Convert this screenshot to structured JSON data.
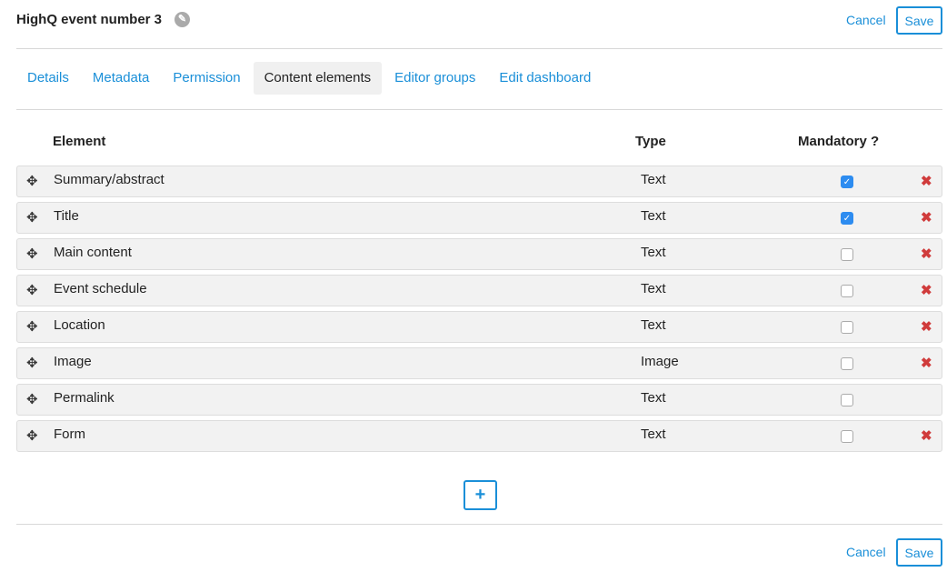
{
  "header": {
    "title": "HighQ event number 3",
    "cancel": "Cancel",
    "save": "Save"
  },
  "tabs": [
    {
      "label": "Details"
    },
    {
      "label": "Metadata"
    },
    {
      "label": "Permission"
    },
    {
      "label": "Content elements",
      "active": true
    },
    {
      "label": "Editor groups"
    },
    {
      "label": "Edit dashboard"
    }
  ],
  "table": {
    "headers": {
      "element": "Element",
      "type": "Type",
      "mandatory": "Mandatory ?"
    },
    "rows": [
      {
        "name": "Summary/abstract",
        "type": "Text",
        "mandatory": true,
        "deletable": true
      },
      {
        "name": "Title",
        "type": "Text",
        "mandatory": true,
        "deletable": true
      },
      {
        "name": "Main content",
        "type": "Text",
        "mandatory": false,
        "deletable": true
      },
      {
        "name": "Event schedule",
        "type": "Text",
        "mandatory": false,
        "deletable": true
      },
      {
        "name": "Location",
        "type": "Text",
        "mandatory": false,
        "deletable": true
      },
      {
        "name": "Image",
        "type": "Image",
        "mandatory": false,
        "deletable": true
      },
      {
        "name": "Permalink",
        "type": "Text",
        "mandatory": false,
        "deletable": false
      },
      {
        "name": "Form",
        "type": "Text",
        "mandatory": false,
        "deletable": true
      }
    ]
  },
  "icons": {
    "handle": "✥",
    "delete": "✖",
    "check": "✓",
    "add": "+",
    "edit": "✎"
  },
  "footer": {
    "cancel": "Cancel",
    "save": "Save"
  }
}
